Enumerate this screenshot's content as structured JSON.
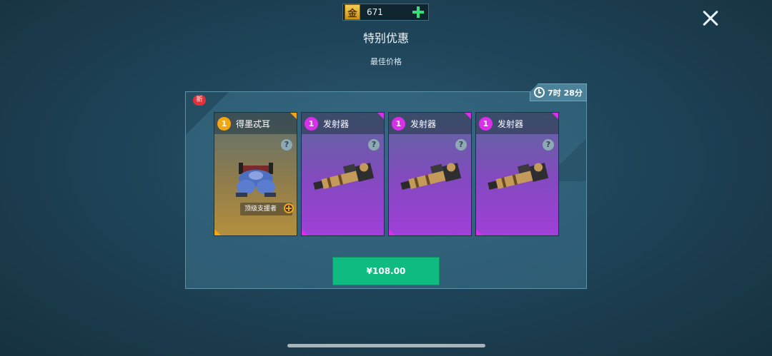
{
  "currency": {
    "icon_text": "金",
    "amount": "671",
    "icon": "gold-coin-icon"
  },
  "header": {
    "title": "特别优惠",
    "subtitle": "最佳价格"
  },
  "offer": {
    "new_badge": "新",
    "timer": "7时 28分",
    "cards": [
      {
        "count": "1",
        "name": "得墨忒耳",
        "rarity": "gold",
        "tag": "顶级支援者"
      },
      {
        "count": "1",
        "name": "发射器",
        "rarity": "purple"
      },
      {
        "count": "1",
        "name": "发射器",
        "rarity": "purple"
      },
      {
        "count": "1",
        "name": "发射器",
        "rarity": "purple"
      }
    ],
    "help_symbol": "?",
    "price": "¥108.00"
  },
  "colors": {
    "gold": "#f3a612",
    "purple": "#d830e8",
    "buy": "#10bb82"
  }
}
